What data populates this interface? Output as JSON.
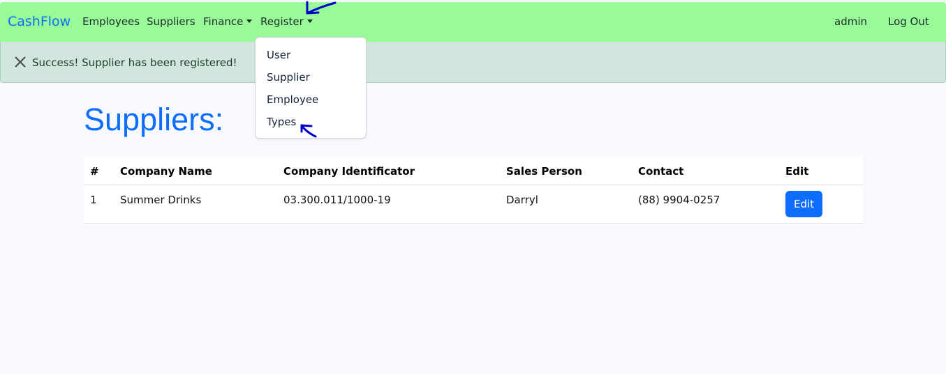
{
  "navbar": {
    "brand": "CashFlow",
    "links": [
      "Employees",
      "Suppliers"
    ],
    "finance_label": "Finance",
    "register_label": "Register",
    "user_label": "admin",
    "logout_label": "Log Out",
    "bg_color": "#98fb98"
  },
  "alert": {
    "message": "Success! Supplier has been registered!",
    "icon": "close-icon"
  },
  "dropdown": {
    "items": [
      "User",
      "Supplier",
      "Employee",
      "Types"
    ]
  },
  "page": {
    "title": "Suppliers:"
  },
  "table": {
    "headers": [
      "#",
      "Company Name",
      "Company Identificator",
      "Sales Person",
      "Contact",
      "Edit"
    ],
    "rows": [
      {
        "num": "1",
        "company": "Summer Drinks",
        "identificator": "03.300.011/1000-19",
        "sales_person": "Darryl",
        "contact": "(88) 9904-0257",
        "edit_label": "Edit"
      }
    ]
  },
  "colors": {
    "accent": "#0d6efd",
    "alert_bg": "#d1e7dd",
    "annotation": "#0000cc"
  }
}
